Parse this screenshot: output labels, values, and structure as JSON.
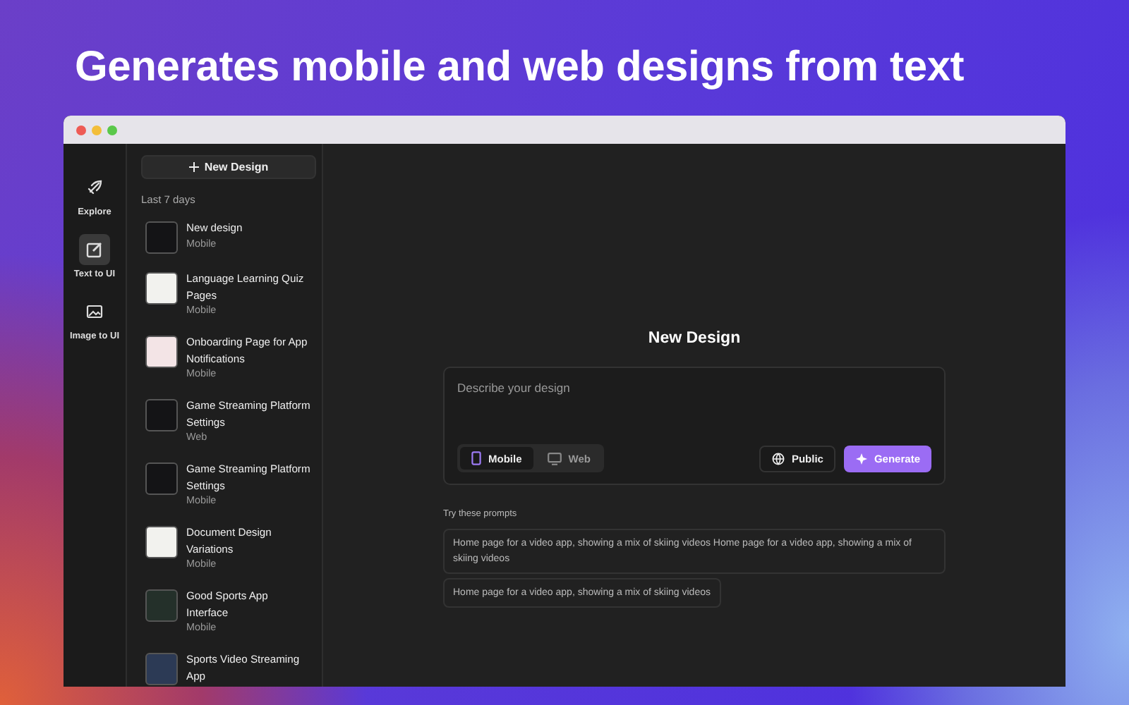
{
  "headline": "Generates mobile and web designs from text",
  "rail": [
    {
      "label": "Explore",
      "selected": false
    },
    {
      "label": "Text to UI",
      "selected": true
    },
    {
      "label": "Image to UI",
      "selected": false
    }
  ],
  "sidebar": {
    "new_button": "New Design",
    "section": "Last 7 days",
    "items": [
      {
        "title": "New design",
        "type": "Mobile"
      },
      {
        "title": "Language Learning Quiz Pages",
        "type": "Mobile"
      },
      {
        "title": "Onboarding Page for App Notifications",
        "type": "Mobile"
      },
      {
        "title": "Game Streaming Platform Settings",
        "type": "Web"
      },
      {
        "title": "Game Streaming Platform Settings",
        "type": "Mobile"
      },
      {
        "title": "Document Design Variations",
        "type": "Mobile"
      },
      {
        "title": "Good Sports App Interface",
        "type": "Mobile"
      },
      {
        "title": "Sports Video Streaming App"
      }
    ]
  },
  "main": {
    "title": "New Design",
    "prompt": {
      "placeholder": "Describe your design"
    },
    "platforms": [
      {
        "label": "Mobile",
        "selected": true
      },
      {
        "label": "Web",
        "selected": false
      }
    ],
    "visibility_button": "Public",
    "generate_button": "Generate",
    "suggestions_label": "Try these prompts",
    "suggestions": [
      "Home page for a video app, showing a mix of skiing videos Home page for a video app, showing a mix of skiing videos",
      "Home page for a video app, showing a mix of skiing videos"
    ]
  }
}
